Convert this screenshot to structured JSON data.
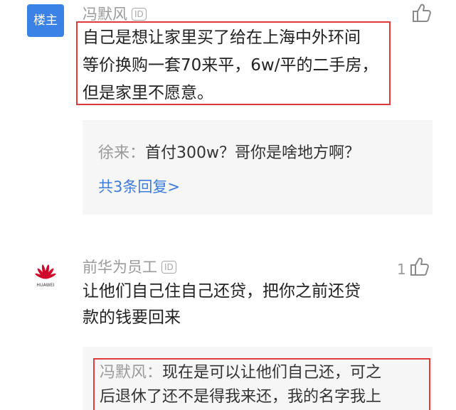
{
  "comment1": {
    "avatar_badge": "楼主",
    "username": "冯默风",
    "id_badge": "ID",
    "lines": [
      "自己是想让家里买了给在上海中外环间",
      "等价换购一套70来平，6w/平的二手房，",
      "但是家里不愿意。"
    ],
    "reply": {
      "author": "徐来",
      "separator": "：",
      "text": "首付300w？哥你是啥地方啊？"
    },
    "more_replies": "共3条回复>"
  },
  "comment2": {
    "avatar_brand": "HUAWEI",
    "username": "前华为员工",
    "id_badge": "ID",
    "like_count": "1",
    "lines": [
      "让他们自己住自己还贷，把你之前还贷",
      "款的钱要回来"
    ],
    "reply": {
      "author": "冯默风",
      "separator": "：",
      "line1": "现在是可以让他们自己还，可之",
      "line2": "后退休了还不是得我来还，我的名字我上"
    }
  },
  "colors": {
    "highlight_border": "#e03a3a",
    "link": "#3b7be0",
    "op_badge": "#3b82e6",
    "huawei_red": "#cf0a2c"
  },
  "icons": [
    "thumbs-up-icon",
    "huawei-logo-icon"
  ]
}
